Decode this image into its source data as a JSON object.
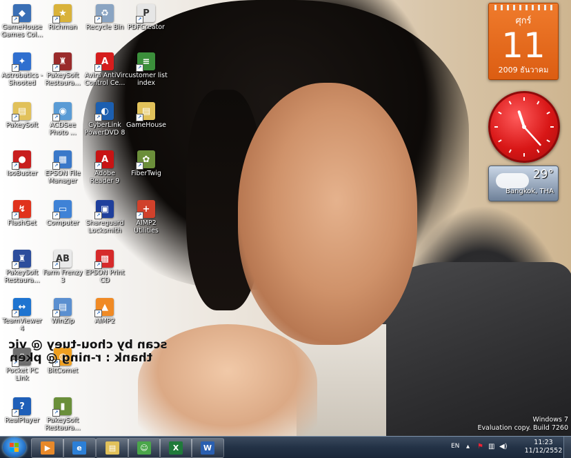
{
  "desktop_icons": [
    {
      "label1": "GameHouse",
      "label2": "Games Col...",
      "color": "#3a6fb5",
      "glyph": "◆"
    },
    {
      "label1": "Richman",
      "label2": "",
      "color": "#d9b23a",
      "glyph": "★"
    },
    {
      "label1": "Recycle Bin",
      "label2": "",
      "color": "#8aa4c2",
      "glyph": "♻"
    },
    {
      "label1": "PDFCreator",
      "label2": "",
      "color": "#e6e6e6",
      "glyph": "P"
    },
    {
      "label1": "Astrobatics -",
      "label2": "Shooted",
      "color": "#2f6fcf",
      "glyph": "✦"
    },
    {
      "label1": "PakeySoft",
      "label2": "Restaura...",
      "color": "#9a2b2b",
      "glyph": "♜"
    },
    {
      "label1": "Avira AntiVir",
      "label2": "Control Ce...",
      "color": "#d51d1d",
      "glyph": "A"
    },
    {
      "label1": "customer list",
      "label2": "index",
      "color": "#3b8f3b",
      "glyph": "≡"
    },
    {
      "label1": "PakeySoft",
      "label2": "",
      "color": "#e1c15a",
      "glyph": "▤"
    },
    {
      "label1": "ACDSee",
      "label2": "Photo ...",
      "color": "#5a9bd5",
      "glyph": "◉"
    },
    {
      "label1": "CyberLink",
      "label2": "PowerDVD 8",
      "color": "#1c5fb0",
      "glyph": "◐"
    },
    {
      "label1": "GameHouse",
      "label2": "",
      "color": "#e1c15a",
      "glyph": "▤"
    },
    {
      "label1": "IsoBuster",
      "label2": "",
      "color": "#c81e1e",
      "glyph": "●"
    },
    {
      "label1": "EPSON File",
      "label2": "Manager",
      "color": "#3a78c9",
      "glyph": "▦"
    },
    {
      "label1": "Adobe",
      "label2": "Reader 9",
      "color": "#c81414",
      "glyph": "A"
    },
    {
      "label1": "FiberTwig",
      "label2": "",
      "color": "#6b8e3a",
      "glyph": "✿"
    },
    {
      "label1": "FlashGet",
      "label2": "",
      "color": "#e0321c",
      "glyph": "↯"
    },
    {
      "label1": "Computer",
      "label2": "",
      "color": "#3f82d6",
      "glyph": "▭"
    },
    {
      "label1": "Shareguard",
      "label2": "Locksmith",
      "color": "#1f3f9c",
      "glyph": "▣"
    },
    {
      "label1": "AIMP2",
      "label2": "Utilities",
      "color": "#d0412b",
      "glyph": "+"
    },
    {
      "label1": "PakeySoft",
      "label2": "Restaura...",
      "color": "#2c4d9c",
      "glyph": "♜"
    },
    {
      "label1": "Farm Frenzy",
      "label2": "3",
      "color": "#e9e9e9",
      "glyph": "AB"
    },
    {
      "label1": "EPSON Print",
      "label2": "CD",
      "color": "#d62a2a",
      "glyph": "▩"
    },
    {
      "label1": "TeamViewer",
      "label2": "4",
      "color": "#1e74d0",
      "glyph": "↔"
    },
    {
      "label1": "WinZip",
      "label2": "",
      "color": "#5b8fd0",
      "glyph": "▤"
    },
    {
      "label1": "AIMP2",
      "label2": "",
      "color": "#f08a24",
      "glyph": "▲"
    },
    {
      "label1": "Pocket PC",
      "label2": "Link",
      "color": "#6e6e6e",
      "glyph": "▯"
    },
    {
      "label1": "BitComet",
      "label2": "",
      "color": "#f0a020",
      "glyph": "◍"
    },
    {
      "label1": "RealPlayer",
      "label2": "",
      "color": "#1f5fb8",
      "glyph": "?"
    },
    {
      "label1": "PakeySoft",
      "label2": "Restaura...",
      "color": "#6a8f3a",
      "glyph": "▮"
    }
  ],
  "wallpaper_text": {
    "line1": "scan by chou-tuey @ vic",
    "line2": "thank : r-ning @ pken"
  },
  "gadgets": {
    "calendar": {
      "day_name": "ศุกร์",
      "day": "11",
      "month_year": "2009 ธันวาคม"
    },
    "clock": {
      "hour": 11,
      "minute": 23
    },
    "weather": {
      "temperature": "29°",
      "city": "Bangkok, THA"
    }
  },
  "watermark": {
    "line1": "Windows 7",
    "line2": "Evaluation copy. Build 7260"
  },
  "taskbar": {
    "apps": [
      {
        "name": "media-player",
        "color": "#e8892a",
        "glyph": "▶"
      },
      {
        "name": "internet-explorer",
        "color": "#2c7fd6",
        "glyph": "e"
      },
      {
        "name": "explorer",
        "color": "#e1c15a",
        "glyph": "▤"
      },
      {
        "name": "messenger",
        "color": "#4aa64a",
        "glyph": "☺"
      },
      {
        "name": "excel",
        "color": "#1f7a3a",
        "glyph": "X"
      },
      {
        "name": "word",
        "color": "#2a5fb0",
        "glyph": "W"
      }
    ],
    "tray": {
      "language": "EN",
      "time": "11:23",
      "date": "11/12/2552"
    }
  }
}
